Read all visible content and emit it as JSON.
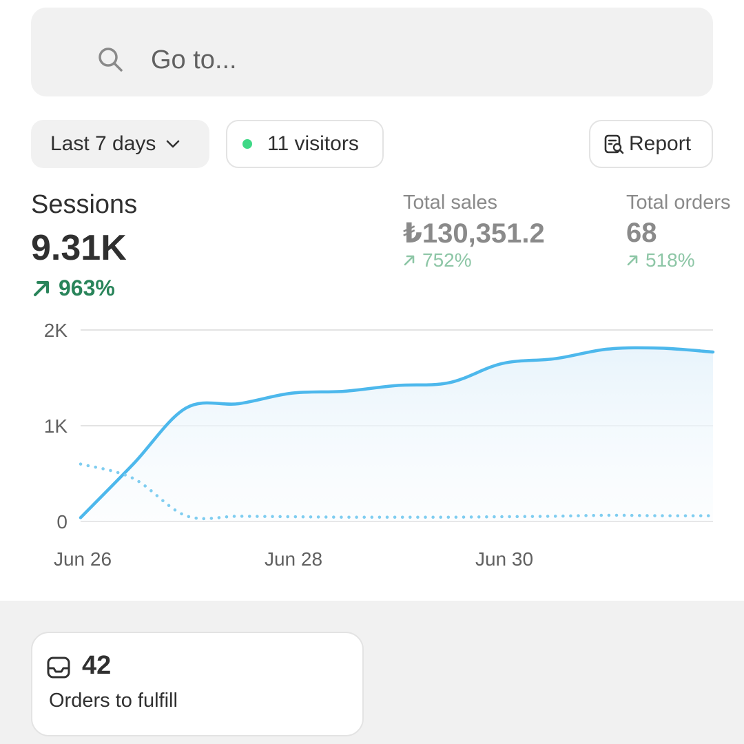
{
  "search": {
    "placeholder": "Go to...",
    "icon": "search-icon"
  },
  "controls": {
    "date_range": "Last 7 days",
    "visitors": "11 visitors",
    "live_dot_color": "#3fd886",
    "report": "Report"
  },
  "metrics": {
    "sessions": {
      "label": "Sessions",
      "value": "9.31K",
      "change": "963%"
    },
    "total_sales": {
      "label": "Total sales",
      "value": "₺130,351.2",
      "change": "752%"
    },
    "total_orders": {
      "label": "Total orders",
      "value": "68",
      "change": "518%"
    }
  },
  "colors": {
    "accent_line": "#4db8ec",
    "positive": "#29845a",
    "positive_muted": "#8dc6a6"
  },
  "chart_data": {
    "type": "line",
    "y_ticks": [
      "0",
      "1K",
      "2K"
    ],
    "x_ticks": [
      "Jun 26",
      "Jun 28",
      "Jun 30"
    ],
    "ylim": [
      0,
      2000
    ],
    "grid": true,
    "series": [
      {
        "style": "solid",
        "x": [
          "Jun 26",
          "Jun 26.5",
          "Jun 27",
          "Jun 27.5",
          "Jun 28",
          "Jun 28.5",
          "Jun 29",
          "Jun 29.5",
          "Jun 30",
          "Jun 30.5",
          "Jun 31",
          "Jul 1",
          "Jul 1.5"
        ],
        "values": [
          40,
          600,
          1185,
          1230,
          1340,
          1360,
          1420,
          1450,
          1650,
          1700,
          1800,
          1810,
          1770
        ]
      },
      {
        "style": "dotted",
        "x": [
          "Jun 26",
          "Jun 26.5",
          "Jun 27",
          "Jun 27.5",
          "Jun 28",
          "Jun 28.5",
          "Jun 29",
          "Jun 29.5",
          "Jun 30",
          "Jun 30.5",
          "Jun 31",
          "Jul 1",
          "Jul 1.5"
        ],
        "values": [
          600,
          450,
          60,
          55,
          50,
          45,
          45,
          45,
          50,
          55,
          65,
          60,
          60
        ]
      }
    ]
  },
  "orders_card": {
    "count": "42",
    "caption": "Orders to fulfill",
    "icon": "inbox-icon"
  }
}
